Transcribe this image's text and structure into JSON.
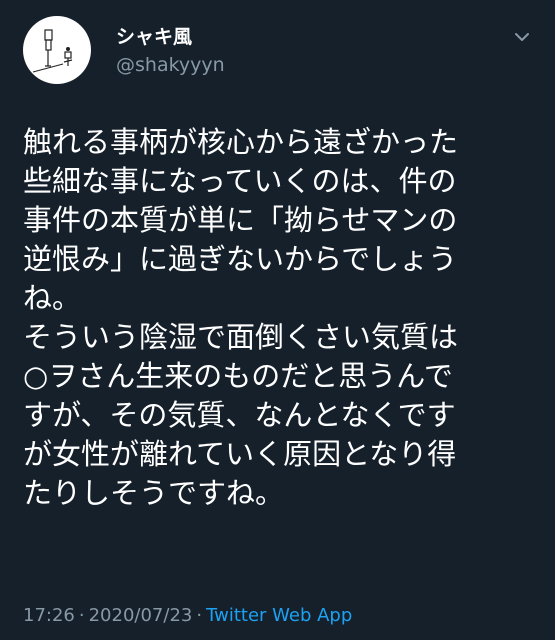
{
  "tweet": {
    "author": {
      "display_name": "シャキ風",
      "handle": "@shakyyyn",
      "avatar_icon": "avatar-drawing"
    },
    "menu_icon": "chevron-down-icon",
    "body_lines": [
      "触れる事柄が核心から遠ざかった",
      "些細な事になっていくのは、件の",
      "事件の本質が単に「拗らせマンの",
      "逆恨み」に過ぎないからでしょう",
      "ね。",
      "そういう陰湿で面倒くさい気質は",
      "○ヲさん生来のものだと思うんで",
      "すが、その気質、なんとなくです",
      "が女性が離れていく原因となり得",
      "たりしそうですね。"
    ],
    "time": "17:26",
    "date": "2020/07/23",
    "separator": "·",
    "source": "Twitter Web App"
  },
  "colors": {
    "background": "#15202b",
    "text": "#ffffff",
    "muted": "#8899a6",
    "link": "#1da1f2"
  }
}
